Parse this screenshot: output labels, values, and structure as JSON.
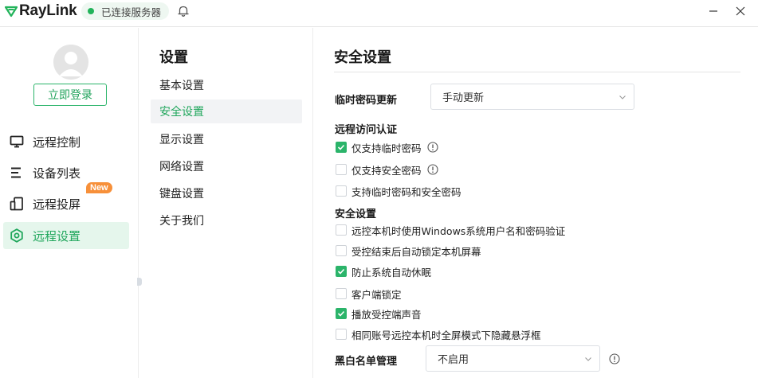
{
  "app": {
    "logo_text": "RayLink",
    "connection_status": "已连接服务器"
  },
  "sidebar": {
    "login_label": "立即登录",
    "items": [
      {
        "label": "远程控制",
        "icon": "monitor-icon"
      },
      {
        "label": "设备列表",
        "icon": "list-icon"
      },
      {
        "label": "远程投屏",
        "icon": "screencast-icon",
        "badge": "New"
      },
      {
        "label": "远程设置",
        "icon": "settings-hex-icon",
        "active": true
      }
    ]
  },
  "menu": {
    "title": "设置",
    "items": [
      {
        "label": "基本设置"
      },
      {
        "label": "安全设置",
        "active": true
      },
      {
        "label": "显示设置"
      },
      {
        "label": "网络设置"
      },
      {
        "label": "键盘设置"
      },
      {
        "label": "关于我们"
      }
    ]
  },
  "main": {
    "title": "安全设置",
    "temp_password": {
      "label": "临时密码更新",
      "value": "手动更新"
    },
    "remote_auth": {
      "title": "远程访问认证",
      "options": [
        {
          "label": "仅支持临时密码",
          "checked": true,
          "info": true
        },
        {
          "label": "仅支持安全密码",
          "checked": false,
          "info": true
        },
        {
          "label": "支持临时密码和安全密码",
          "checked": false,
          "info": false
        }
      ]
    },
    "security": {
      "title": "安全设置",
      "options": [
        {
          "label": "远控本机时使用Windows系统用户名和密码验证",
          "checked": false
        },
        {
          "label": "受控结束后自动锁定本机屏幕",
          "checked": false
        },
        {
          "label": "防止系统自动休眠",
          "checked": true
        },
        {
          "label": "客户端锁定",
          "checked": false
        },
        {
          "label": "播放受控端声音",
          "checked": true
        },
        {
          "label": "相同账号远控本机时全屏模式下隐藏悬浮框",
          "checked": false
        }
      ]
    },
    "blacklist": {
      "label": "黑白名单管理",
      "value": "不启用"
    }
  },
  "colors": {
    "accent": "#2bb46a",
    "active_bg": "#e5f6ec",
    "badge": "#f7903a"
  }
}
